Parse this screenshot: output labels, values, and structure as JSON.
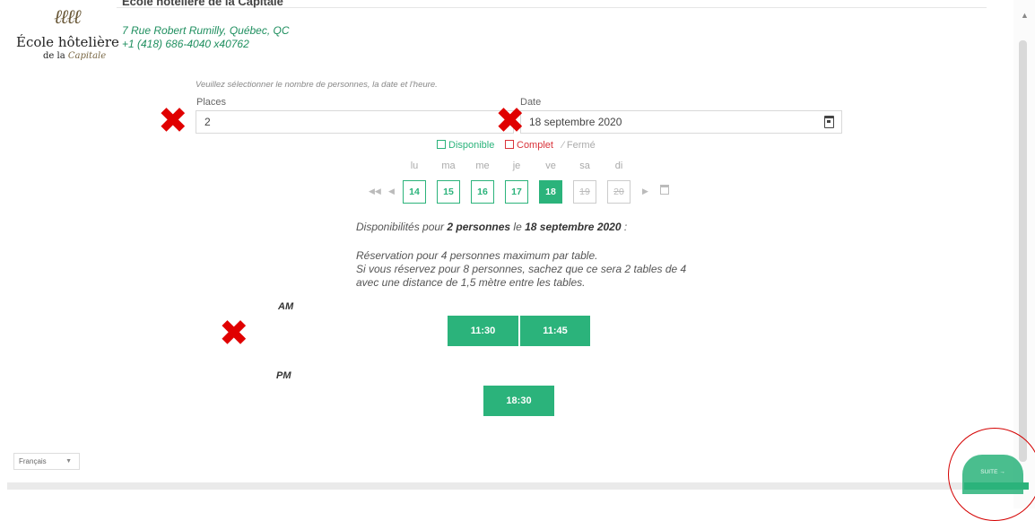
{
  "header": {
    "org_name": "École hôtelière de la Capitale",
    "address": "7 Rue Robert Rumilly, Québec, QC",
    "phone": "+1 (418) 686-4040 x40762",
    "logo": {
      "line1": "École hôtelière",
      "line2_prefix": "de la ",
      "line2_script": "Capitale"
    }
  },
  "form": {
    "instructions": "Veuillez sélectionner le nombre de personnes, la date et l'heure.",
    "places_label": "Places",
    "places_value": "2",
    "date_label": "Date",
    "date_value": "18 septembre 2020"
  },
  "legend": {
    "available": "Disponible",
    "full": "Complet",
    "closed": "Fermé"
  },
  "calendar": {
    "weekdays": [
      "lu",
      "ma",
      "me",
      "je",
      "ve",
      "sa",
      "di"
    ],
    "days": [
      {
        "label": "14",
        "state": "available"
      },
      {
        "label": "15",
        "state": "available"
      },
      {
        "label": "16",
        "state": "available"
      },
      {
        "label": "17",
        "state": "available"
      },
      {
        "label": "18",
        "state": "selected"
      },
      {
        "label": "19",
        "state": "closed"
      },
      {
        "label": "20",
        "state": "closed"
      }
    ],
    "nav": {
      "first": "◀◀",
      "prev": "◀",
      "next": "▶"
    }
  },
  "availability": {
    "prefix": "Disponibilités pour ",
    "people": "2 personnes",
    "middle": " le ",
    "date": "18 septembre 2020",
    "suffix": " :"
  },
  "notes": {
    "line1": "Réservation pour 4 personnes maximum par table.",
    "line2": "Si vous réservez pour 8 personnes, sachez que ce sera 2 tables de 4 avec une distance de 1,5 mètre entre les tables."
  },
  "slots": {
    "am_label": "AM",
    "am": [
      "11:30",
      "11:45"
    ],
    "pm_label": "PM",
    "pm": [
      "18:30"
    ]
  },
  "footer": {
    "language": "Français",
    "next_button": "SUITE →"
  },
  "annotations": {
    "cross": "✖"
  },
  "colors": {
    "accent": "#2bb37b",
    "full": "#d9333a",
    "annotation": "#e00000"
  }
}
